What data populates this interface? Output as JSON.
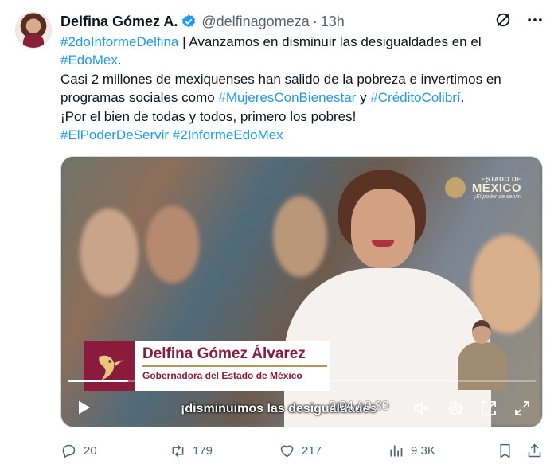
{
  "author": {
    "name": "Delfina Gómez A.",
    "handle": "@delfinagomeza",
    "separator": "·",
    "time": "13h"
  },
  "tweet": {
    "line1_tag": "#2doInformeDelfina",
    "line1_text": " | Avanzamos en disminuir las desigualdades en el",
    "line2_tag": "#EdoMex",
    "line2_text": ".",
    "line3": "Casi 2 millones de mexiquenses han salido de la pobreza e invertimos en",
    "line4_text": "programas sociales como ",
    "line4_tag1": "#MujeresConBienestar",
    "line4_mid": " y ",
    "line4_tag2": "#CréditoColibrí",
    "line4_end": ".",
    "line5": "¡Por el bien de todas y todos, primero los pobres!",
    "line6_tag1": "#ElPoderDeServir",
    "line6_sep": " ",
    "line6_tag2": "#2InformeEdoMex"
  },
  "video": {
    "lower_third_name": "Delfina Gómez Álvarez",
    "lower_third_title": "Gobernadora del Estado de México",
    "logo_small": "ESTADO DE",
    "logo_big": "MÉXICO",
    "logo_tagline": "¡El poder de servir!",
    "subtitle": "¡disminuimos las desigualdades",
    "time_display": "0:04 / 0:30",
    "progress": 0.13
  },
  "actions": {
    "replies": "20",
    "reposts": "179",
    "likes": "217",
    "views": "9.3K"
  },
  "colors": {
    "link": "#1d9bf0",
    "muted": "#536471",
    "brand": "#8a1b3d"
  }
}
